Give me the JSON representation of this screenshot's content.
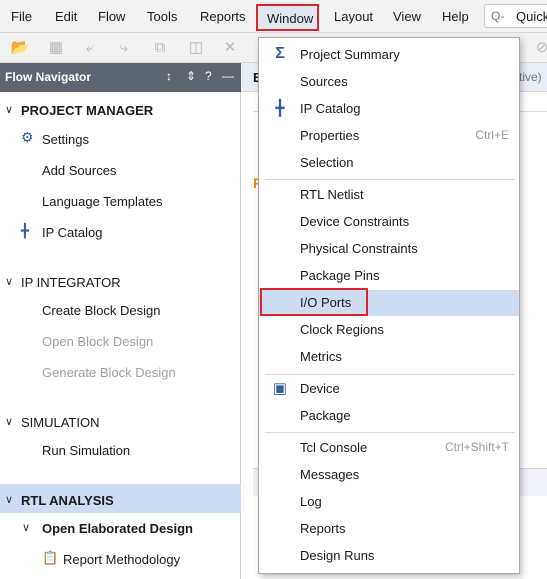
{
  "menubar": {
    "items": [
      "File",
      "Edit",
      "Flow",
      "Tools",
      "Reports",
      "Window",
      "Layout",
      "View",
      "Help"
    ],
    "quick_access_label": "Quick"
  },
  "flow_navigator": {
    "title": "Flow Navigator",
    "sections": {
      "project_manager": {
        "title": "PROJECT MANAGER",
        "items": [
          "Settings",
          "Add Sources",
          "Language Templates",
          "IP Catalog"
        ]
      },
      "ip_integrator": {
        "title": "IP INTEGRATOR",
        "items": [
          "Create Block Design",
          "Open Block Design",
          "Generate Block Design"
        ]
      },
      "simulation": {
        "title": "SIMULATION",
        "items": [
          "Run Simulation"
        ]
      },
      "rtl_analysis": {
        "title": "RTL ANALYSIS",
        "items": [
          "Open Elaborated Design",
          "Report Methodology"
        ]
      }
    }
  },
  "right_pane": {
    "tab_label": "E",
    "active_suffix": "ctive)"
  },
  "window_menu": {
    "items": [
      {
        "label": "Project Summary",
        "icon": "sigma-icon"
      },
      {
        "label": "Sources"
      },
      {
        "label": "IP Catalog",
        "icon": "ip-icon"
      },
      {
        "label": "Properties",
        "shortcut": "Ctrl+E"
      },
      {
        "label": "Selection"
      },
      {
        "label": "RTL Netlist"
      },
      {
        "label": "Device Constraints"
      },
      {
        "label": "Physical Constraints"
      },
      {
        "label": "Package Pins"
      },
      {
        "label": "I/O Ports",
        "highlighted": true
      },
      {
        "label": "Clock Regions"
      },
      {
        "label": "Metrics"
      },
      {
        "label": "Device",
        "icon": "chip-icon"
      },
      {
        "label": "Package"
      },
      {
        "label": "Tcl Console",
        "shortcut": "Ctrl+Shift+T"
      },
      {
        "label": "Messages"
      },
      {
        "label": "Log"
      },
      {
        "label": "Reports"
      },
      {
        "label": "Design Runs"
      }
    ]
  },
  "colors": {
    "highlight_box": "#d9252b",
    "selection_bg": "#cddcf2",
    "nav_header_bg": "#5d6670",
    "icon_blue": "#2f5f9f"
  }
}
